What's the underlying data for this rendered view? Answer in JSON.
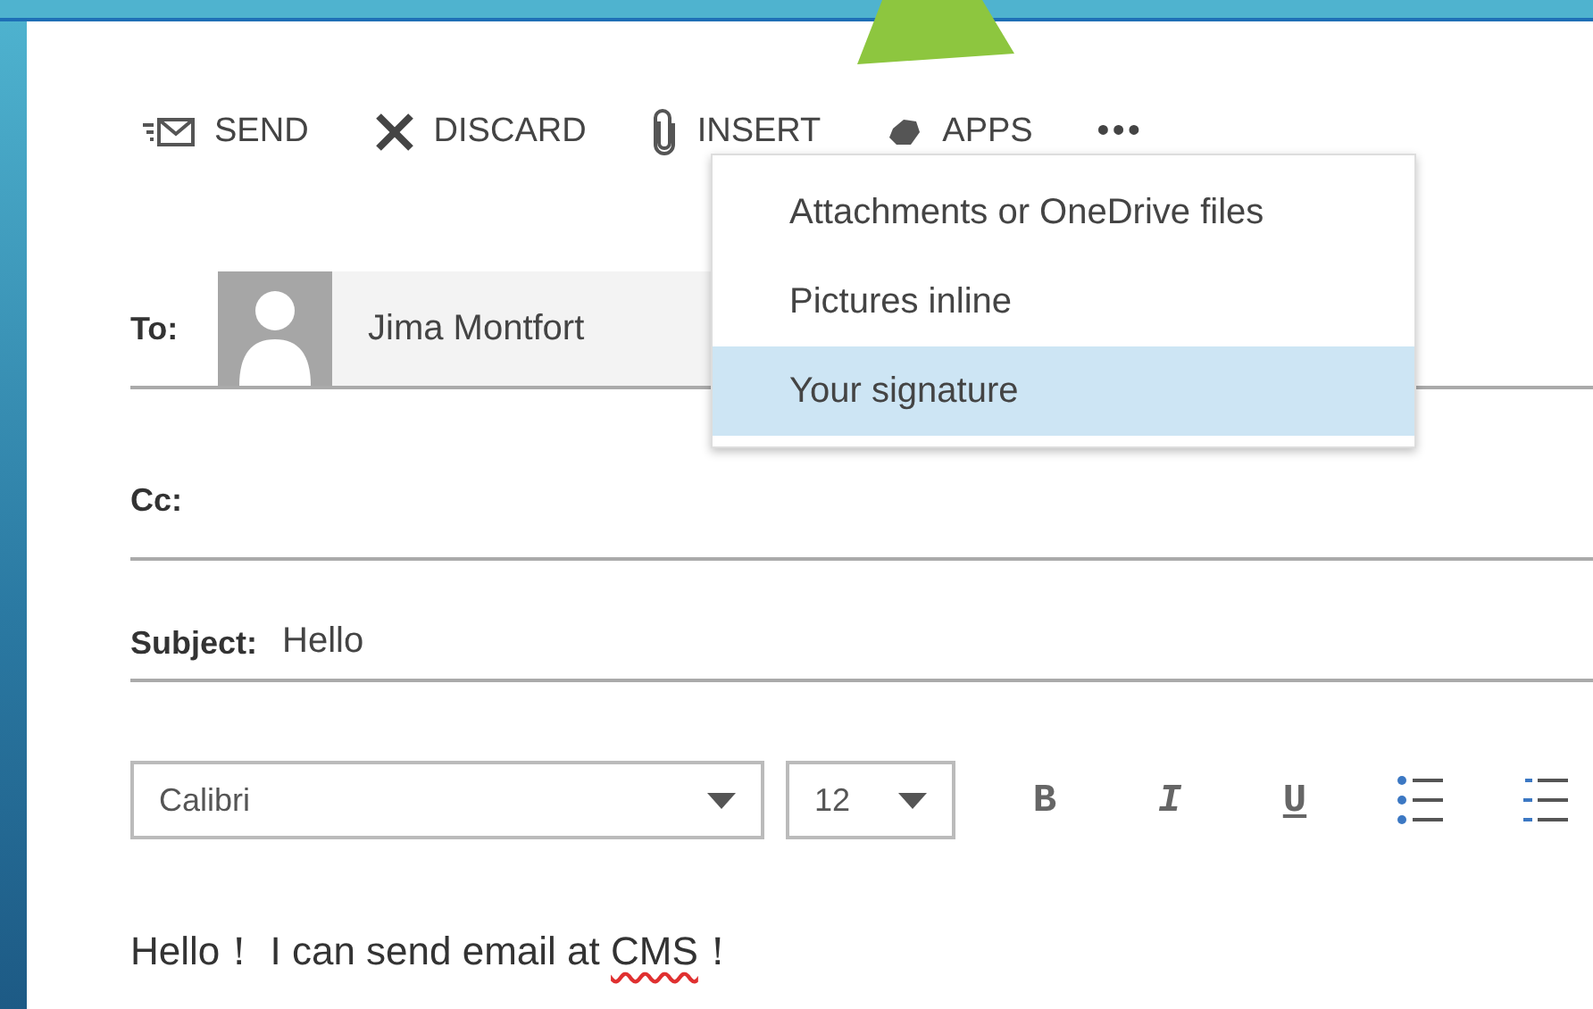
{
  "toolbar": [
    {
      "kind": "send",
      "label": "SEND"
    },
    {
      "kind": "discard",
      "label": "DISCARD"
    },
    {
      "kind": "insert",
      "label": "INSERT",
      "expanded": true
    },
    {
      "kind": "apps",
      "label": "APPS"
    },
    {
      "kind": "more",
      "label": "•••"
    }
  ],
  "insert_menu": [
    {
      "label": "Attachments or OneDrive files",
      "selected": false
    },
    {
      "label": "Pictures inline",
      "selected": false
    },
    {
      "label": "Your signature",
      "selected": true
    }
  ],
  "to": {
    "label": "To:",
    "recipients": [
      {
        "name": "Jima Montfort"
      }
    ]
  },
  "cc": {
    "label": "Cc:"
  },
  "subject": {
    "label": "Subject:",
    "value": "Hello"
  },
  "format_bar": {
    "font": "Calibri",
    "size": "12",
    "buttons": [
      {
        "kind": "bold",
        "label": "B"
      },
      {
        "kind": "italic",
        "label": "I"
      },
      {
        "kind": "underline",
        "label": "U"
      },
      {
        "kind": "bullets"
      },
      {
        "kind": "numbering"
      }
    ]
  },
  "body": [
    {
      "text": "Hello！ I can send email at ",
      "misspelled": false
    },
    {
      "text": "CMS",
      "misspelled": true
    },
    {
      "text": "！",
      "misspelled": false
    }
  ]
}
